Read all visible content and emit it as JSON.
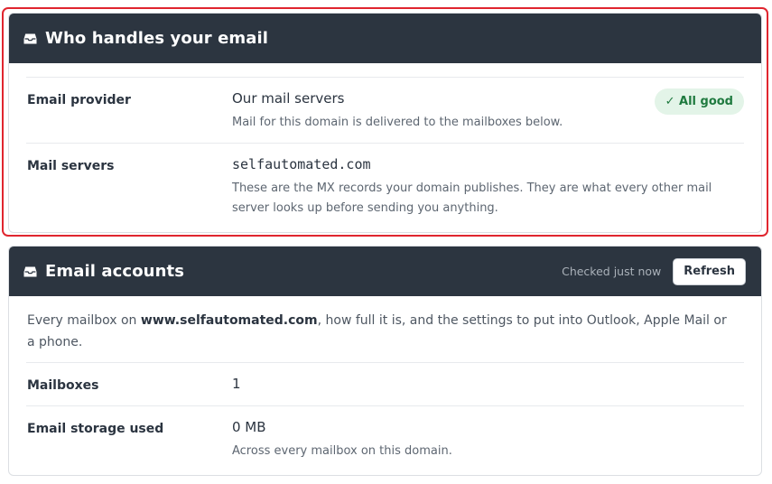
{
  "colors": {
    "header_bg": "#2c3540",
    "highlight_border": "#e0262f",
    "badge_bg": "#e3f4e8",
    "badge_text": "#1f7a3f"
  },
  "mail_card": {
    "icon": "inbox-icon",
    "title": "Who handles your email",
    "rows": [
      {
        "label": "Email provider",
        "value": "Our mail servers",
        "help": "Mail for this domain is delivered to the mailboxes below.",
        "status_badge": "✓ All good"
      },
      {
        "label": "Mail servers",
        "value": "selfautomated.com",
        "help": "These are the MX records your domain publishes. They are what every other mail server looks up before sending you anything."
      }
    ]
  },
  "accounts_card": {
    "icon": "inbox-icon",
    "title": "Email accounts",
    "checked_text": "Checked just now",
    "refresh_label": "Refresh",
    "intro_prefix": "Every mailbox on ",
    "intro_domain": "www.selfautomated.com",
    "intro_suffix": ", how full it is, and the settings to put into Outlook, Apple Mail or a phone.",
    "rows": [
      {
        "label": "Mailboxes",
        "value": "1"
      },
      {
        "label": "Email storage used",
        "value": "0 MB",
        "help": "Across every mailbox on this domain."
      }
    ]
  }
}
